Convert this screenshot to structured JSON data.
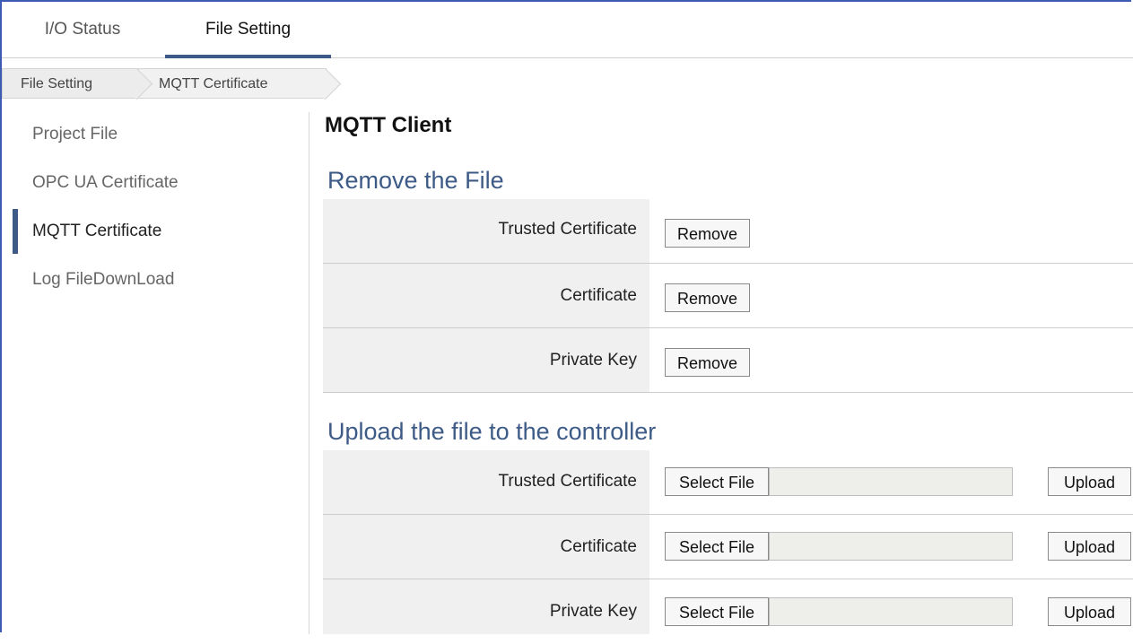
{
  "tabs": [
    {
      "label": "I/O Status",
      "active": false
    },
    {
      "label": "File Setting",
      "active": true
    }
  ],
  "breadcrumb": [
    "File Setting",
    "MQTT Certificate"
  ],
  "sidebar": {
    "items": [
      {
        "label": "Project File",
        "active": false
      },
      {
        "label": "OPC UA Certificate",
        "active": false
      },
      {
        "label": "MQTT Certificate",
        "active": true
      },
      {
        "label": "Log FileDownLoad",
        "active": false
      }
    ]
  },
  "main": {
    "title": "MQTT Client",
    "remove_section": {
      "title": "Remove the File",
      "rows": [
        {
          "label": "Trusted Certificate",
          "button": "Remove"
        },
        {
          "label": "Certificate",
          "button": "Remove"
        },
        {
          "label": "Private Key",
          "button": "Remove"
        }
      ]
    },
    "upload_section": {
      "title": "Upload the file to the controller",
      "rows": [
        {
          "label": "Trusted Certificate",
          "select_button": "Select File",
          "file_value": "",
          "upload_button": "Upload"
        },
        {
          "label": "Certificate",
          "select_button": "Select File",
          "file_value": "",
          "upload_button": "Upload"
        },
        {
          "label": "Private Key",
          "select_button": "Select File",
          "file_value": "",
          "upload_button": "Upload"
        }
      ]
    }
  },
  "colors": {
    "accent": "#3d5b86",
    "frame_border": "#3b5bb5",
    "label_bg": "#f0f0f0"
  }
}
